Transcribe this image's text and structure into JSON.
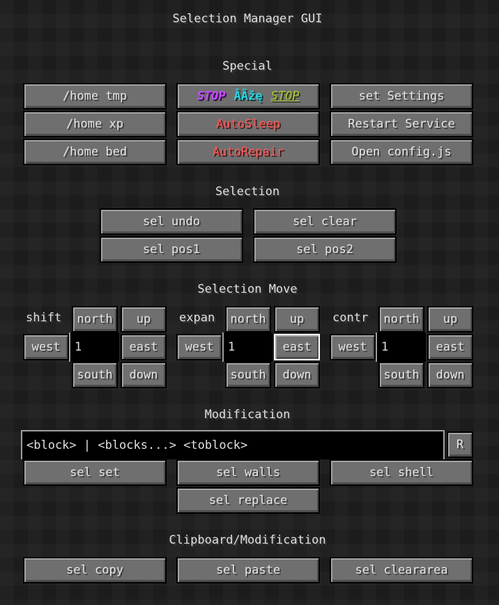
{
  "title": "Selection Manager GUI",
  "special": {
    "heading": "Special",
    "col1": [
      "/home tmp",
      "/home xp",
      "/home bed"
    ],
    "stop_button": {
      "part1": "STOP",
      "part2": "ÂÃžę",
      "part3": "STOP"
    },
    "col2": [
      "AutoSleep",
      "AutoRepair"
    ],
    "col3": [
      "set Settings",
      "Restart Service",
      "Open config.js"
    ]
  },
  "selection": {
    "heading": "Selection",
    "buttons": [
      "sel undo",
      "sel clear",
      "sel pos1",
      "sel pos2"
    ]
  },
  "selection_move": {
    "heading": "Selection Move",
    "groups": [
      {
        "label": "shift",
        "value": "1"
      },
      {
        "label": "expan",
        "value": "1"
      },
      {
        "label": "contr",
        "value": "1"
      }
    ],
    "dirs": {
      "north": "north",
      "up": "up",
      "west": "west",
      "east": "east",
      "south": "south",
      "down": "down"
    }
  },
  "modification": {
    "heading": "Modification",
    "input_value": "<block> | <blocks...> <toblock>",
    "r_button": "R",
    "buttons": [
      "sel set",
      "sel walls",
      "sel shell",
      "sel replace"
    ]
  },
  "clipboard": {
    "heading": "Clipboard/Modification",
    "buttons": [
      "sel copy",
      "sel paste",
      "sel cleararea"
    ]
  }
}
